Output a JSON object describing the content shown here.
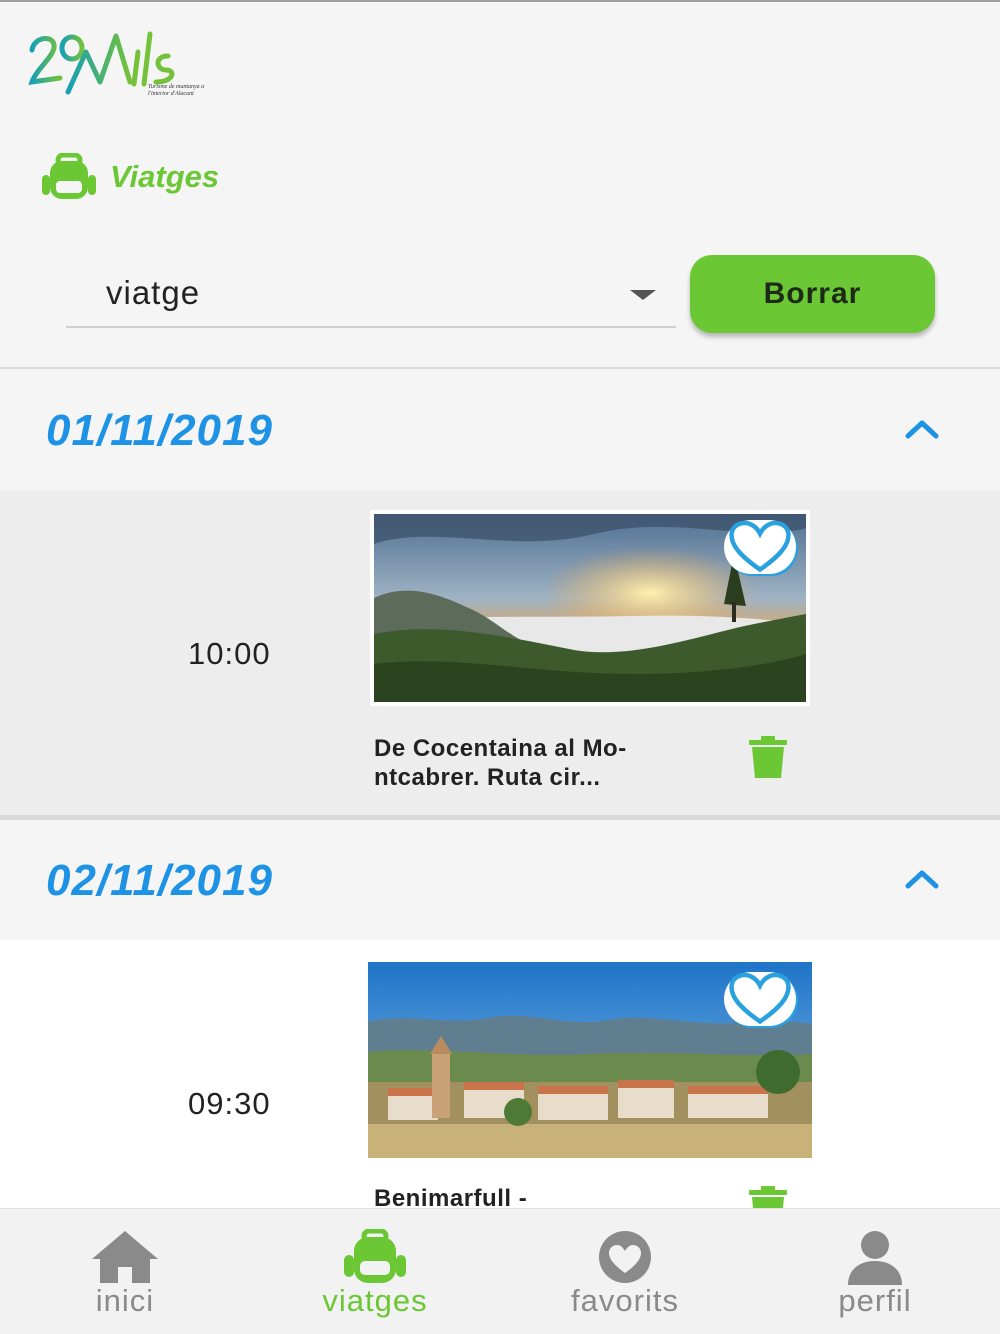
{
  "header": {
    "logo_text": "20Mils",
    "logo_tagline": "Turisme de muntanya a l'interior d'Alacant",
    "section_title": "Viatges",
    "section_icon": "backpack-icon"
  },
  "controls": {
    "select_value": "viatge",
    "clear_button_label": "Borrar"
  },
  "days": [
    {
      "date": "01/11/2019",
      "entries": [
        {
          "time": "10:00",
          "title_line1": "De Cocentaina al Mo-",
          "title_line2": "ntcabrer. Ruta cir..."
        }
      ]
    },
    {
      "date": "02/11/2019",
      "entries": [
        {
          "time": "09:30",
          "title_line1": "Benimarfull -",
          "title_line2": ""
        }
      ]
    }
  ],
  "bottom_nav": [
    {
      "label": "inici",
      "icon": "home-icon",
      "active": false
    },
    {
      "label": "viatges",
      "icon": "backpack-icon",
      "active": true
    },
    {
      "label": "favorits",
      "icon": "heart-icon",
      "active": false
    },
    {
      "label": "perfil",
      "icon": "person-icon",
      "active": false
    }
  ],
  "colors": {
    "accent_green": "#6bc734",
    "date_blue": "#1e93e6",
    "heart_blue": "#2aa1df",
    "nav_inactive": "#8a8a8a"
  }
}
